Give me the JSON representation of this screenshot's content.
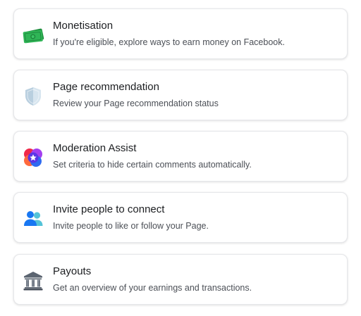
{
  "items": [
    {
      "title": "Monetisation",
      "subtitle": "If you're eligible, explore ways to earn money on Facebook.",
      "icon": "money-icon"
    },
    {
      "title": "Page recommendation",
      "subtitle": "Review your Page recommendation status",
      "icon": "shield-icon"
    },
    {
      "title": "Moderation Assist",
      "subtitle": "Set criteria to hide certain comments automatically.",
      "icon": "moderation-star-icon"
    },
    {
      "title": "Invite people to connect",
      "subtitle": "Invite people to like or follow your Page.",
      "icon": "people-icon"
    },
    {
      "title": "Payouts",
      "subtitle": "Get an overview of your earnings and transactions.",
      "icon": "bank-icon"
    }
  ],
  "colors": {
    "money_green": "#27a74a",
    "shield_blue": "#c9dbe8",
    "moderation_purple": "#6a3df0",
    "moderation_red": "#f0284a",
    "people_blue": "#1877f2",
    "people_teal": "#54c3d8",
    "bank_gray": "#5b6470"
  }
}
